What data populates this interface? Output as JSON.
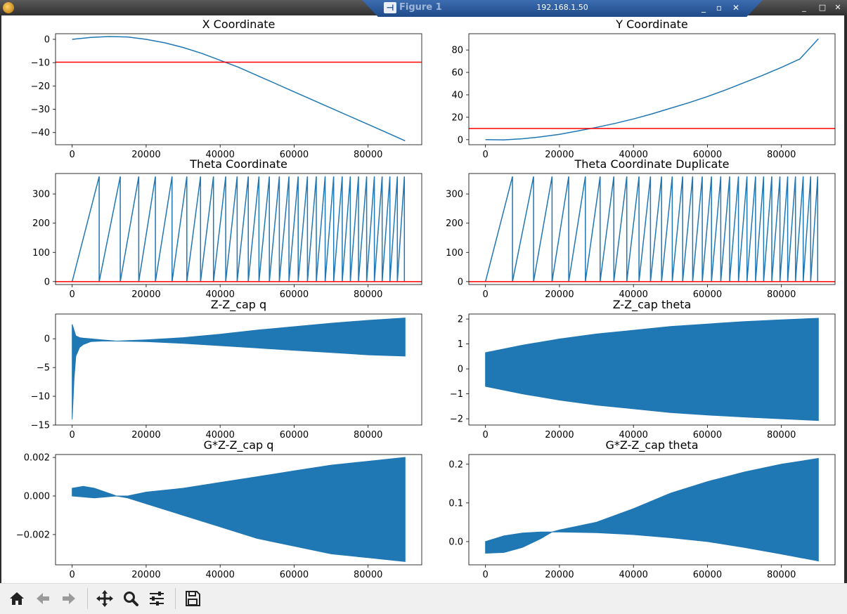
{
  "window": {
    "title": "Figure 1",
    "remote_host": "192.168.1.50",
    "remote_buttons": [
      "_",
      "▫",
      "✕"
    ],
    "wm_buttons": [
      "_",
      "□",
      "✕"
    ]
  },
  "toolbar": {
    "buttons": [
      {
        "name": "home-button",
        "icon": "home-icon"
      },
      {
        "name": "back-button",
        "icon": "arrow-left-icon"
      },
      {
        "name": "forward-button",
        "icon": "arrow-right-icon"
      },
      {
        "name": "pan-button",
        "icon": "move-icon"
      },
      {
        "name": "zoom-button",
        "icon": "magnifier-icon"
      },
      {
        "name": "configure-subplots-button",
        "icon": "sliders-icon"
      },
      {
        "name": "save-button",
        "icon": "floppy-disk-icon"
      }
    ]
  },
  "colors": {
    "series": "#1f77b4",
    "reference_line": "#ff0000",
    "axes": "#000000"
  },
  "chart_data": [
    {
      "type": "line",
      "title": "X Coordinate",
      "x": [
        0,
        5000,
        10000,
        15000,
        20000,
        25000,
        30000,
        35000,
        40000,
        45000,
        50000,
        55000,
        60000,
        65000,
        70000,
        75000,
        80000,
        85000,
        90000
      ],
      "series": [
        {
          "values": [
            0,
            0.8,
            1.2,
            1.0,
            0.0,
            -1.5,
            -3.5,
            -6.0,
            -9.0,
            -12.0,
            -15.5,
            -19.0,
            -22.5,
            -26.0,
            -29.5,
            -33.0,
            -36.5,
            -40.0,
            -43.5
          ]
        }
      ],
      "hline": -9.8,
      "xlim": [
        -4500,
        94500
      ],
      "ylim": [
        -45.2,
        2.4
      ],
      "xticks": [
        0,
        20000,
        40000,
        60000,
        80000
      ],
      "yticks": [
        0,
        -10,
        -20,
        -30,
        -40
      ],
      "xticklabels": [
        "0",
        "20000",
        "40000",
        "60000",
        "80000"
      ],
      "yticklabels": [
        "0",
        "−10",
        "−20",
        "−30",
        "−40"
      ]
    },
    {
      "type": "line",
      "title": "Y Coordinate",
      "x": [
        0,
        5000,
        10000,
        15000,
        20000,
        25000,
        30000,
        35000,
        40000,
        45000,
        50000,
        55000,
        60000,
        65000,
        70000,
        75000,
        80000,
        85000,
        90000
      ],
      "series": [
        {
          "values": [
            0,
            -0.2,
            0.8,
            2.5,
            4.8,
            7.8,
            11.0,
            14.5,
            18.5,
            23.0,
            28.0,
            33.0,
            38.5,
            44.5,
            51.0,
            57.5,
            64.5,
            72.0,
            90.0
          ]
        }
      ],
      "hline": 10,
      "xlim": [
        -4500,
        94500
      ],
      "ylim": [
        -4.5,
        94.5
      ],
      "xticks": [
        0,
        20000,
        40000,
        60000,
        80000
      ],
      "yticks": [
        0,
        20,
        40,
        60,
        80
      ],
      "xticklabels": [
        "0",
        "20000",
        "40000",
        "60000",
        "80000"
      ],
      "yticklabels": [
        "0",
        "20",
        "40",
        "60",
        "80"
      ]
    },
    {
      "type": "line",
      "title": "Theta Coordinate",
      "wrap_points": [
        0,
        7300,
        13000,
        18000,
        22500,
        27000,
        31000,
        34700,
        38200,
        41500,
        44600,
        47600,
        50500,
        53300,
        56000,
        58600,
        61100,
        63600,
        66000,
        68400,
        70700,
        73000,
        75200,
        77400,
        79600,
        81700,
        83800,
        85900,
        87900,
        89800
      ],
      "end_value": 335,
      "peak": 360,
      "hline": 0,
      "xlim": [
        -4500,
        94500
      ],
      "ylim": [
        -10,
        370
      ],
      "xticks": [
        0,
        20000,
        40000,
        60000,
        80000
      ],
      "yticks": [
        0,
        100,
        200,
        300
      ],
      "xticklabels": [
        "0",
        "20000",
        "40000",
        "60000",
        "80000"
      ],
      "yticklabels": [
        "0",
        "100",
        "200",
        "300"
      ]
    },
    {
      "type": "line",
      "title": "Theta Coordinate Duplicate",
      "wrap_points": [
        0,
        7300,
        13000,
        18000,
        22500,
        27000,
        31000,
        34700,
        38200,
        41500,
        44600,
        47600,
        50500,
        53300,
        56000,
        58600,
        61100,
        63600,
        66000,
        68400,
        70700,
        73000,
        75200,
        77400,
        79600,
        81700,
        83800,
        85900,
        87900,
        89800
      ],
      "end_value": 335,
      "peak": 360,
      "hline": 0,
      "xlim": [
        -4500,
        94500
      ],
      "ylim": [
        -10,
        370
      ],
      "xticks": [
        0,
        20000,
        40000,
        60000,
        80000
      ],
      "yticks": [
        0,
        100,
        200,
        300
      ],
      "xticklabels": [
        "0",
        "20000",
        "40000",
        "60000",
        "80000"
      ],
      "yticklabels": [
        "0",
        "100",
        "200",
        "300"
      ]
    },
    {
      "type": "area",
      "title": "Z-Z_cap q",
      "x": [
        0,
        500,
        1000,
        2000,
        3000,
        5000,
        8000,
        12000,
        20000,
        30000,
        40000,
        50000,
        60000,
        70000,
        80000,
        90000
      ],
      "upper": [
        2.5,
        1.5,
        0.5,
        0.2,
        0.1,
        0.0,
        -0.2,
        -0.4,
        -0.2,
        0.2,
        0.8,
        1.5,
        2.1,
        2.7,
        3.2,
        3.6
      ],
      "lower": [
        -14.0,
        -7.0,
        -3.0,
        -1.5,
        -1.0,
        -0.5,
        -0.4,
        -0.4,
        -0.5,
        -0.8,
        -1.2,
        -1.6,
        -2.0,
        -2.4,
        -2.8,
        -3.0
      ],
      "xlim": [
        -4500,
        94500
      ],
      "ylim": [
        -15,
        4.3
      ],
      "xticks": [
        0,
        20000,
        40000,
        60000,
        80000
      ],
      "yticks": [
        0,
        -5,
        -10,
        -15
      ],
      "xticklabels": [
        "0",
        "20000",
        "40000",
        "60000",
        "80000"
      ],
      "yticklabels": [
        "0",
        "−5",
        "−10",
        "−15"
      ]
    },
    {
      "type": "area",
      "title": "Z-Z_cap theta",
      "x": [
        0,
        10000,
        20000,
        30000,
        40000,
        50000,
        60000,
        70000,
        80000,
        90000
      ],
      "upper": [
        0.65,
        0.95,
        1.2,
        1.4,
        1.55,
        1.7,
        1.8,
        1.9,
        1.97,
        2.03
      ],
      "lower": [
        -0.7,
        -1.0,
        -1.25,
        -1.45,
        -1.6,
        -1.75,
        -1.85,
        -1.93,
        -2.0,
        -2.07
      ],
      "xlim": [
        -4500,
        94500
      ],
      "ylim": [
        -2.25,
        2.2
      ],
      "xticks": [
        0,
        20000,
        40000,
        60000,
        80000
      ],
      "yticks": [
        2,
        1,
        0,
        -1,
        -2
      ],
      "xticklabels": [
        "0",
        "20000",
        "40000",
        "60000",
        "80000"
      ],
      "yticklabels": [
        "2",
        "1",
        "0",
        "−1",
        "−2"
      ]
    },
    {
      "type": "area",
      "title": "G*Z-Z_cap q",
      "x": [
        0,
        3000,
        6000,
        9000,
        12000,
        15000,
        20000,
        30000,
        40000,
        50000,
        60000,
        70000,
        80000,
        90000
      ],
      "upper": [
        0.0004,
        0.0005,
        0.0004,
        0.0002,
        0.0,
        0.0,
        0.0002,
        0.0004,
        0.0007,
        0.001,
        0.0013,
        0.0016,
        0.0018,
        0.002
      ],
      "lower": [
        0.0,
        -5e-05,
        -0.0001,
        -5e-05,
        0.0,
        -0.0001,
        -0.0004,
        -0.001,
        -0.0016,
        -0.0022,
        -0.0026,
        -0.003,
        -0.0032,
        -0.0034
      ],
      "xlim": [
        -4500,
        94500
      ],
      "ylim": [
        -0.00357,
        0.00215
      ],
      "xticks": [
        0,
        20000,
        40000,
        60000,
        80000
      ],
      "yticks": [
        0.002,
        0.0,
        -0.002
      ],
      "xticklabels": [
        "0",
        "20000",
        "40000",
        "60000",
        "80000"
      ],
      "yticklabels": [
        "0.002",
        "0.000",
        "−0.002"
      ]
    },
    {
      "type": "area",
      "title": "G*Z-Z_cap theta",
      "x": [
        0,
        5000,
        10000,
        15000,
        18000,
        20000,
        30000,
        40000,
        50000,
        60000,
        70000,
        80000,
        90000
      ],
      "upper": [
        0.0,
        0.015,
        0.022,
        0.025,
        0.025,
        0.03,
        0.05,
        0.085,
        0.125,
        0.155,
        0.18,
        0.2,
        0.215
      ],
      "lower": [
        -0.03,
        -0.028,
        -0.015,
        0.008,
        0.025,
        0.025,
        0.023,
        0.018,
        0.01,
        0.0,
        -0.015,
        -0.032,
        -0.05
      ],
      "xlim": [
        -4500,
        94500
      ],
      "ylim": [
        -0.06,
        0.225
      ],
      "xticks": [
        0,
        20000,
        40000,
        60000,
        80000
      ],
      "yticks": [
        0.2,
        0.1,
        0.0
      ],
      "xticklabels": [
        "0",
        "20000",
        "40000",
        "60000",
        "80000"
      ],
      "yticklabels": [
        "0.2",
        "0.1",
        "0.0"
      ]
    }
  ]
}
